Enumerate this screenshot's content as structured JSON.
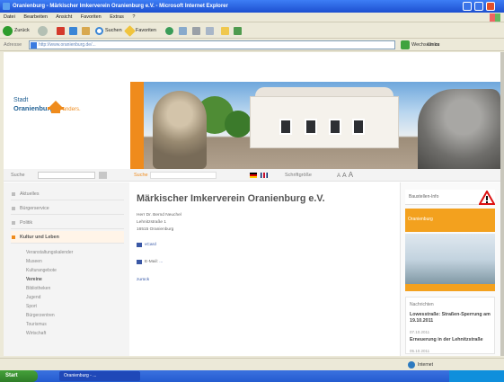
{
  "window": {
    "title": "Oranienburg - Märkischer Imkerverein Oranienburg e.V. - Microsoft Internet Explorer"
  },
  "menu": [
    "Datei",
    "Bearbeiten",
    "Ansicht",
    "Favoriten",
    "Extras",
    "?"
  ],
  "toolbar": {
    "back": "Zurück",
    "search": "Suchen",
    "favorites": "Favoriten"
  },
  "address": {
    "label": "Adresse",
    "url": "http://www.oranienburg.de/...",
    "go_label": "Wechseln zu",
    "links_label": "Links"
  },
  "site": {
    "logo_top": "Stadt",
    "logo_name": "Oranienburg",
    "logo_tag": "ist anders.",
    "search_label": "Suche",
    "search_placeholder": "",
    "schrift_label": "Suche",
    "schrift_right": "Schriftgröße",
    "sizes": [
      "A",
      "A",
      "A"
    ]
  },
  "sidebar": {
    "items": [
      {
        "label": "Aktuelles"
      },
      {
        "label": "Bürgerservice"
      },
      {
        "label": "Politik"
      },
      {
        "label": "Kultur und Leben"
      }
    ],
    "subitems": [
      "Veranstaltungskalender",
      "Museen",
      "Kulturangebote",
      "Vereine",
      "Bibliotheken",
      "Jugend",
      "Sport",
      "Bürgerzentren",
      "Tourismus",
      "Wirtschaft"
    ]
  },
  "content": {
    "title": "Märkischer Imkerverein Oranienburg e.V.",
    "lines": [
      "Herr Dr. Bernd Neuchel",
      "Lehnitzstraße 1",
      "16515 Oranienburg"
    ],
    "vcard": "vCard",
    "email_label": "E-Mail:",
    "email": "...",
    "back_link": "zurück"
  },
  "right": {
    "header": "Baustellen-Info",
    "promo_text": "Oranienburg",
    "news_title": "Nachrichten",
    "news1": "Lowesstraße: Straßen-Sperrung am 19.10.2011",
    "date1": "07.10.2011",
    "news2": "Erneuerung in der Lehnitzstraße",
    "date2": "05.10.2011"
  },
  "status": {
    "internet": "Internet"
  },
  "taskbar": {
    "start": "Start",
    "task": "Oranienburg - ..."
  },
  "colors": {
    "orange": "#ef8b1c",
    "blue": "#1f5f93",
    "xp_blue": "#245bd0"
  }
}
